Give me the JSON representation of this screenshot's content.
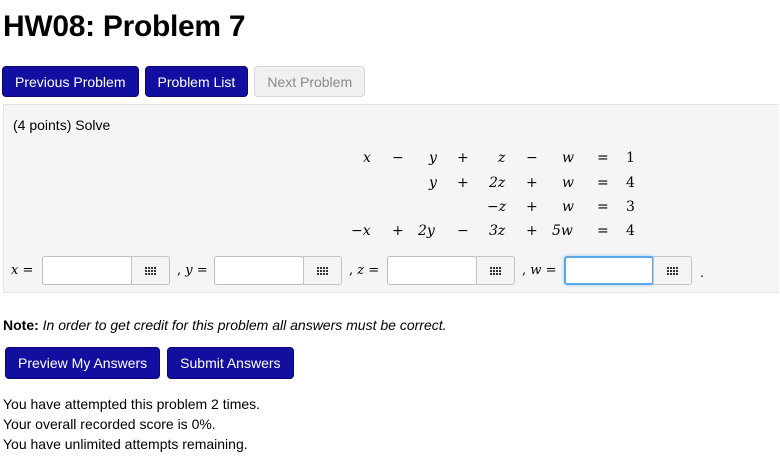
{
  "title": "HW08: Problem 7",
  "nav": {
    "previous_label": "Previous Problem",
    "list_label": "Problem List",
    "next_label": "Next Problem"
  },
  "problem": {
    "points": "(4 points) Solve",
    "equations": {
      "row1": [
        "x",
        "−",
        "y",
        "+",
        "z",
        "−",
        "w",
        "=",
        "1"
      ],
      "row2": [
        "y",
        "+",
        "2z",
        "+",
        "w",
        "=",
        "4"
      ],
      "row3": [
        "−z",
        "+",
        "w",
        "=",
        "3"
      ],
      "row4": [
        "−x",
        "+",
        "2y",
        "−",
        "3z",
        "+",
        "5w",
        "=",
        "4"
      ]
    },
    "answers": {
      "x_label": "x",
      "y_label": "y",
      "z_label": "z",
      "w_label": "w",
      "equals": "=",
      "comma": ",",
      "period": ".",
      "x_value": "",
      "y_value": "",
      "z_value": "",
      "w_value": ""
    }
  },
  "note": {
    "label": "Note:",
    "text": "In order to get credit for this problem all answers must be correct."
  },
  "actions": {
    "preview_label": "Preview My Answers",
    "submit_label": "Submit Answers"
  },
  "status": {
    "attempts": "You have attempted this problem 2 times.",
    "score": "Your overall recorded score is 0%.",
    "remaining": "You have unlimited attempts remaining."
  },
  "colors": {
    "primary_button": "#120ea0",
    "focus_ring": "#5aa7e8",
    "panel_bg": "#f5f5f5"
  },
  "icons": {
    "equation_editor": "grid-icon"
  }
}
